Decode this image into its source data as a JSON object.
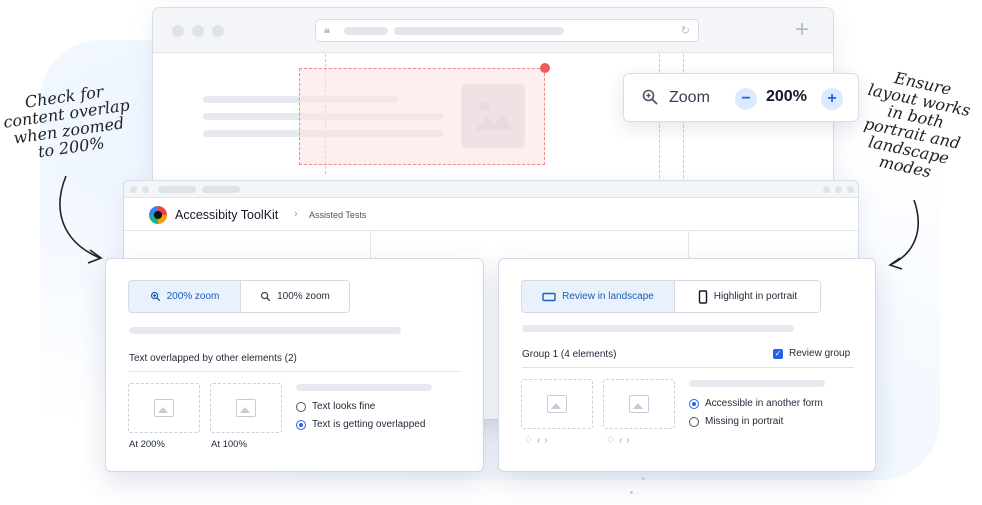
{
  "zoom_popup": {
    "label": "Zoom",
    "value": "200%",
    "minus": "−",
    "plus": "+"
  },
  "annotations": {
    "left": "Check for\ncontent overlap\nwhen zoomed\nto 200%",
    "right": "Ensure\nlayout works\nin both\nportrait and\nlandscape\nmodes"
  },
  "app": {
    "title": "Accessibity ToolKit",
    "breadcrumb": "Assisted Tests"
  },
  "left_card": {
    "tabs": [
      {
        "label": "200% zoom",
        "active": true,
        "icon": "zoom-in-icon"
      },
      {
        "label": "100% zoom",
        "active": false,
        "icon": "zoom-out-icon"
      }
    ],
    "heading": "Text overlapped by other elements (2)",
    "thumbnails": [
      "At 200%",
      "At 100%"
    ],
    "options": [
      {
        "label": "Text looks fine",
        "selected": false
      },
      {
        "label": "Text is getting overlapped",
        "selected": true
      }
    ]
  },
  "right_card": {
    "tabs": [
      {
        "label": "Review in landscape",
        "active": true,
        "icon": "landscape-icon"
      },
      {
        "label": "Highlight in portrait",
        "active": false,
        "icon": "portrait-icon"
      }
    ],
    "heading": "Group 1 (4 elements)",
    "checkbox_label": "Review group",
    "options": [
      {
        "label": "Accessible in another form",
        "selected": true
      },
      {
        "label": "Missing in portrait",
        "selected": false
      }
    ]
  },
  "colors": {
    "accent": "#2563eb",
    "active_tab_bg": "#e8f1fc",
    "overlap_red": "#ef5b5b"
  }
}
